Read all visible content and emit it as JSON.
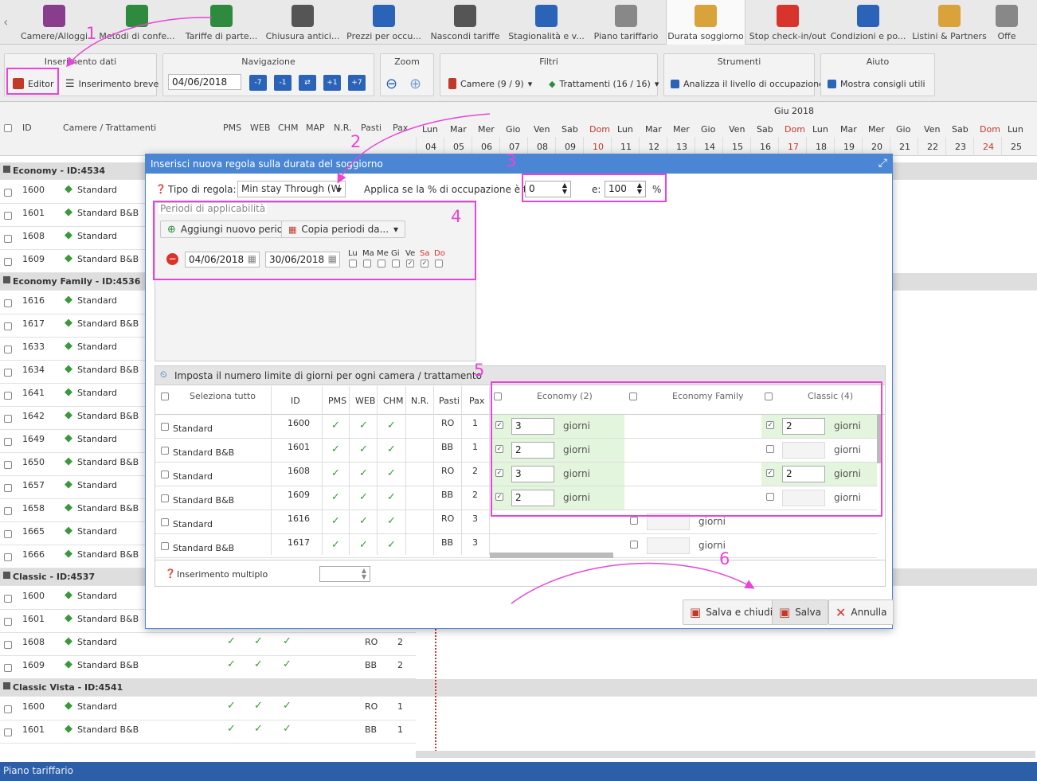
{
  "nav": {
    "items": [
      {
        "label": "Camere/Alloggi",
        "color": "#8a3d8c"
      },
      {
        "label": "Metodi di confe...",
        "color": "#2e8b3e"
      },
      {
        "label": "Tariffe di parte...",
        "color": "#2e8b3e"
      },
      {
        "label": "Chiusura antici...",
        "color": "#555555"
      },
      {
        "label": "Prezzi per occu...",
        "color": "#2a63b8"
      },
      {
        "label": "Nascondi tariffe",
        "color": "#555555"
      },
      {
        "label": "Stagionalità e v...",
        "color": "#2a63b8"
      },
      {
        "label": "Piano tariffario",
        "color": "#888888"
      },
      {
        "label": "Durata soggiorno",
        "color": "#d9a23a"
      },
      {
        "label": "Stop check-in/out",
        "color": "#d9342b"
      },
      {
        "label": "Condizioni e po...",
        "color": "#2a63b8"
      },
      {
        "label": "Listini & Partners",
        "color": "#d9a23a"
      },
      {
        "label": "Offe",
        "color": "#888888"
      }
    ]
  },
  "ribbon": {
    "inserimento": {
      "title": "Inserimento dati",
      "editor": "Editor",
      "breve": "Inserimento breve"
    },
    "navigazione": {
      "title": "Navigazione",
      "date": "04/06/2018",
      "btns": [
        "-7",
        "-1",
        "⇄",
        "+1",
        "+7"
      ]
    },
    "zoom": {
      "title": "Zoom"
    },
    "filtri": {
      "title": "Filtri",
      "camere": "Camere (9 / 9)",
      "trattamenti": "Trattamenti (16 / 16)"
    },
    "strumenti": {
      "title": "Strumenti",
      "analizza": "Analizza il livello di occupazione"
    },
    "aiuto": {
      "title": "Aiuto",
      "consigli": "Mostra consigli utili"
    }
  },
  "grid": {
    "headers": {
      "id": "ID",
      "camere": "Camere / Trattamenti",
      "pms": "PMS",
      "web": "WEB",
      "chm": "CHM",
      "map": "MAP",
      "nr": "N.R.",
      "pasti": "Pasti",
      "pax": "Pax"
    },
    "month": "Giu 2018",
    "days": [
      {
        "d": "Lun",
        "n": "04"
      },
      {
        "d": "Mar",
        "n": "05"
      },
      {
        "d": "Mer",
        "n": "06"
      },
      {
        "d": "Gio",
        "n": "07"
      },
      {
        "d": "Ven",
        "n": "08"
      },
      {
        "d": "Sab",
        "n": "09"
      },
      {
        "d": "Dom",
        "n": "10"
      },
      {
        "d": "Lun",
        "n": "11"
      },
      {
        "d": "Mar",
        "n": "12"
      },
      {
        "d": "Mer",
        "n": "13"
      },
      {
        "d": "Gio",
        "n": "14"
      },
      {
        "d": "Ven",
        "n": "15"
      },
      {
        "d": "Sab",
        "n": "16"
      },
      {
        "d": "Dom",
        "n": "17"
      },
      {
        "d": "Lun",
        "n": "18"
      },
      {
        "d": "Mar",
        "n": "19"
      },
      {
        "d": "Mer",
        "n": "20"
      },
      {
        "d": "Gio",
        "n": "21"
      },
      {
        "d": "Ven",
        "n": "22"
      },
      {
        "d": "Sab",
        "n": "23"
      },
      {
        "d": "Dom",
        "n": "24"
      },
      {
        "d": "Lun",
        "n": "25"
      }
    ],
    "rows": [
      {
        "g": "Economy - ID:4534"
      },
      {
        "id": "1600",
        "t": "Standard"
      },
      {
        "id": "1601",
        "t": "Standard B&B"
      },
      {
        "id": "1608",
        "t": "Standard"
      },
      {
        "id": "1609",
        "t": "Standard B&B"
      },
      {
        "g": "Economy Family - ID:4536"
      },
      {
        "id": "1616",
        "t": "Standard"
      },
      {
        "id": "1617",
        "t": "Standard B&B"
      },
      {
        "id": "1633",
        "t": "Standard"
      },
      {
        "id": "1634",
        "t": "Standard B&B"
      },
      {
        "id": "1641",
        "t": "Standard"
      },
      {
        "id": "1642",
        "t": "Standard B&B"
      },
      {
        "id": "1649",
        "t": "Standard"
      },
      {
        "id": "1650",
        "t": "Standard B&B"
      },
      {
        "id": "1657",
        "t": "Standard"
      },
      {
        "id": "1658",
        "t": "Standard B&B"
      },
      {
        "id": "1665",
        "t": "Standard"
      },
      {
        "id": "1666",
        "t": "Standard B&B"
      },
      {
        "g": "Classic - ID:4537"
      },
      {
        "id": "1600",
        "t": "Standard"
      },
      {
        "id": "1601",
        "t": "Standard B&B"
      },
      {
        "id": "1608",
        "t": "Standard",
        "v": true,
        "p": "RO",
        "x": "2"
      },
      {
        "id": "1609",
        "t": "Standard B&B",
        "v": true,
        "p": "BB",
        "x": "2"
      },
      {
        "g": "Classic Vista - ID:4541"
      },
      {
        "id": "1600",
        "t": "Standard",
        "v": true,
        "p": "RO",
        "x": "1"
      },
      {
        "id": "1601",
        "t": "Standard B&B",
        "v": true,
        "p": "BB",
        "x": "1"
      }
    ]
  },
  "status": "Piano tariffario",
  "modal": {
    "title": "Inserisci nuova regola sulla durata del soggiorno",
    "tipo_label": "Tipo di regola:",
    "tipo_value": "Min stay Through (W",
    "applica_label": "Applica se la % di occupazione è tra:",
    "occ_from": "0",
    "e_label": "e:",
    "occ_to": "100",
    "pct": "%",
    "periodi_title": "Periodi di applicabilità",
    "aggiungi": "Aggiungi nuovo periodo",
    "copia": "Copia periodi da...",
    "date_from": "04/06/2018",
    "date_to": "30/06/2018",
    "weekdays": [
      {
        "l": "Lu",
        "c": false
      },
      {
        "l": "Ma",
        "c": false
      },
      {
        "l": "Me",
        "c": false
      },
      {
        "l": "Gi",
        "c": false
      },
      {
        "l": "Ve",
        "c": true
      },
      {
        "l": "Sa",
        "c": true
      },
      {
        "l": "Do",
        "c": false
      }
    ],
    "limite_title": "Imposta il numero limite di giorni per ogni camera / trattamento",
    "table": {
      "headers": {
        "sel": "Seleziona tutto",
        "id": "ID",
        "pms": "PMS",
        "web": "WEB",
        "chm": "CHM",
        "nr": "N.R.",
        "pasti": "Pasti",
        "pax": "Pax"
      },
      "rooms": [
        "Economy (2)",
        "Economy Family",
        "Classic (4)"
      ],
      "rows": [
        {
          "t": "Standard",
          "id": "1600",
          "p": "RO",
          "x": "1",
          "e": "3",
          "c": "2"
        },
        {
          "t": "Standard B&B",
          "id": "1601",
          "p": "BB",
          "x": "1",
          "e": "2",
          "c": ""
        },
        {
          "t": "Standard",
          "id": "1608",
          "p": "RO",
          "x": "2",
          "e": "3",
          "c": "2"
        },
        {
          "t": "Standard B&B",
          "id": "1609",
          "p": "BB",
          "x": "2",
          "e": "2",
          "c": ""
        },
        {
          "t": "Standard",
          "id": "1616",
          "p": "RO",
          "x": "3"
        },
        {
          "t": "Standard B&B",
          "id": "1617",
          "p": "BB",
          "x": "3"
        }
      ],
      "giorni": "giorni"
    },
    "multiplo": "Inserimento multiplo",
    "salva_chiudi": "Salva e chiudi",
    "salva": "Salva",
    "annulla": "Annulla"
  },
  "annotations": [
    "1",
    "2",
    "3",
    "4",
    "5",
    "6"
  ]
}
